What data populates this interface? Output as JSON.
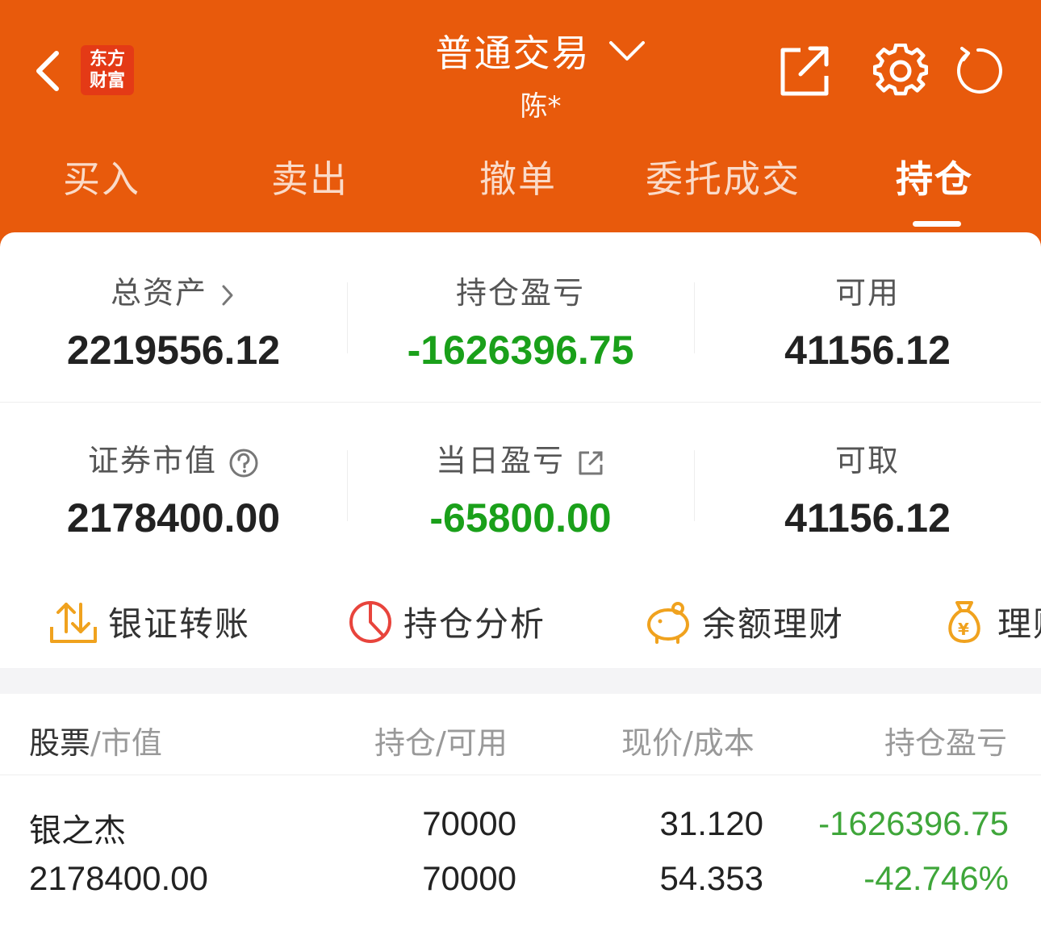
{
  "header": {
    "logo_line1": "东方",
    "logo_line2": "财富",
    "title": "普通交易",
    "subtitle": "陈*"
  },
  "tabs": [
    {
      "label": "买入"
    },
    {
      "label": "卖出"
    },
    {
      "label": "撤单"
    },
    {
      "label": "委托成交"
    },
    {
      "label": "持仓",
      "active": true
    }
  ],
  "summary": {
    "total_assets": {
      "label": "总资产",
      "value": "2219556.12"
    },
    "position_pnl": {
      "label": "持仓盈亏",
      "value": "-1626396.75"
    },
    "available": {
      "label": "可用",
      "value": "41156.12"
    },
    "market_value": {
      "label": "证券市值",
      "value": "2178400.00"
    },
    "daily_pnl": {
      "label": "当日盈亏",
      "value": "-65800.00"
    },
    "withdrawable": {
      "label": "可取",
      "value": "41156.12"
    }
  },
  "quick_actions": [
    {
      "label": "银证转账",
      "icon": "transfer-icon"
    },
    {
      "label": "持仓分析",
      "icon": "pie-chart-icon"
    },
    {
      "label": "余额理财",
      "icon": "piggy-bank-icon"
    },
    {
      "label": "理财",
      "icon": "money-bag-icon"
    }
  ],
  "table": {
    "col1_a": "股票",
    "col1_b": "/市值",
    "col2": "持仓/可用",
    "col3": "现价/成本",
    "col4": "持仓盈亏",
    "rows": [
      {
        "name": "银之杰",
        "market_value": "2178400.00",
        "position": "70000",
        "available": "70000",
        "price": "31.120",
        "cost": "54.353",
        "pnl": "-1626396.75",
        "pnl_pct": "-42.746%"
      }
    ]
  },
  "colors": {
    "brand": "#e85a0c",
    "loss": "#1aa01a"
  }
}
